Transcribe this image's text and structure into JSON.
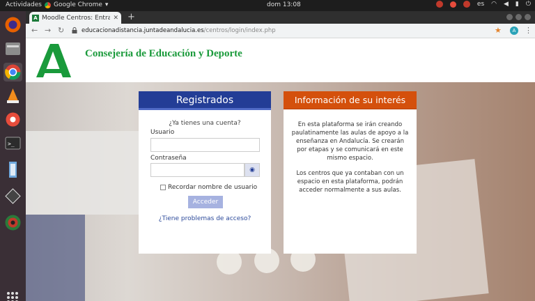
{
  "os": {
    "activities": "Actividades",
    "app_name": "Google Chrome",
    "clock": "dom 13:08",
    "lang": "es"
  },
  "browser": {
    "tab_title": "Moodle Centros: Entrar a",
    "tab_favicon": "A",
    "url_host": "educacionadistancia.juntadeandalucia.es",
    "url_path": "/centros/login/index.php",
    "profile_initial": "A"
  },
  "header": {
    "organization": "Consejería de Educación y Deporte"
  },
  "login": {
    "title": "Registrados",
    "question": "¿Ya tienes una cuenta?",
    "username_label": "Usuario",
    "username_value": "",
    "password_label": "Contraseña",
    "password_value": "",
    "remember_label": "Recordar nombre de usuario",
    "remember_checked": false,
    "submit_label": "Acceder",
    "help_link": "¿Tiene problemas de acceso?"
  },
  "info": {
    "title": "Información de su interés",
    "paragraphs": [
      "En esta plataforma se irán creando paulatinamente las aulas de apoyo a la enseñanza en Andalucía. Se crearán por etapas y se comunicará en este mismo espacio.",
      "Los centros que ya contaban con un espacio en esta plataforma, podrán acceder normalmente a sus aulas."
    ]
  },
  "colors": {
    "login_header": "#233d96",
    "info_header": "#d4500c",
    "brand_green": "#1a9a3b",
    "dock_bg": "#3a2f36"
  }
}
